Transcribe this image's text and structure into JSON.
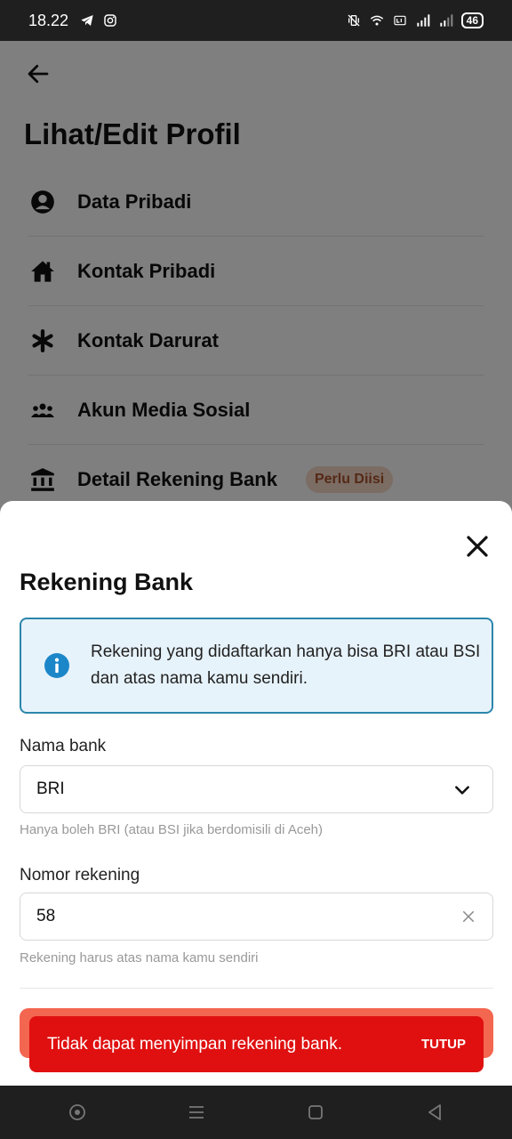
{
  "status_bar": {
    "time": "18.22",
    "battery": "46"
  },
  "page": {
    "title": "Lihat/Edit Profil",
    "menu": [
      {
        "label": "Data Pribadi",
        "icon": "account-circle-icon"
      },
      {
        "label": "Kontak Pribadi",
        "icon": "house-icon"
      },
      {
        "label": "Kontak Darurat",
        "icon": "asterisk-icon"
      },
      {
        "label": "Akun Media Sosial",
        "icon": "group-icon"
      },
      {
        "label": "Detail Rekening Bank",
        "icon": "bank-icon",
        "badge": "Perlu Diisi"
      }
    ]
  },
  "sheet": {
    "title": "Rekening Bank",
    "info": "Rekening yang didaftarkan hanya bisa BRI atau BSI dan atas nama kamu sendiri.",
    "bank_label": "Nama bank",
    "bank_value": "BRI",
    "bank_helper": "Hanya boleh BRI (atau BSI jika berdomisili di Aceh)",
    "account_label": "Nomor rekening",
    "account_value": "58",
    "account_helper": "Rekening harus atas nama kamu sendiri"
  },
  "snackbar": {
    "message": "Tidak dapat menyimpan rekening bank.",
    "action": "TUTUP"
  },
  "colors": {
    "accent": "#2b86ac",
    "error": "#e01010",
    "badge_bg": "#f7d9c8",
    "badge_text": "#a9532b"
  }
}
